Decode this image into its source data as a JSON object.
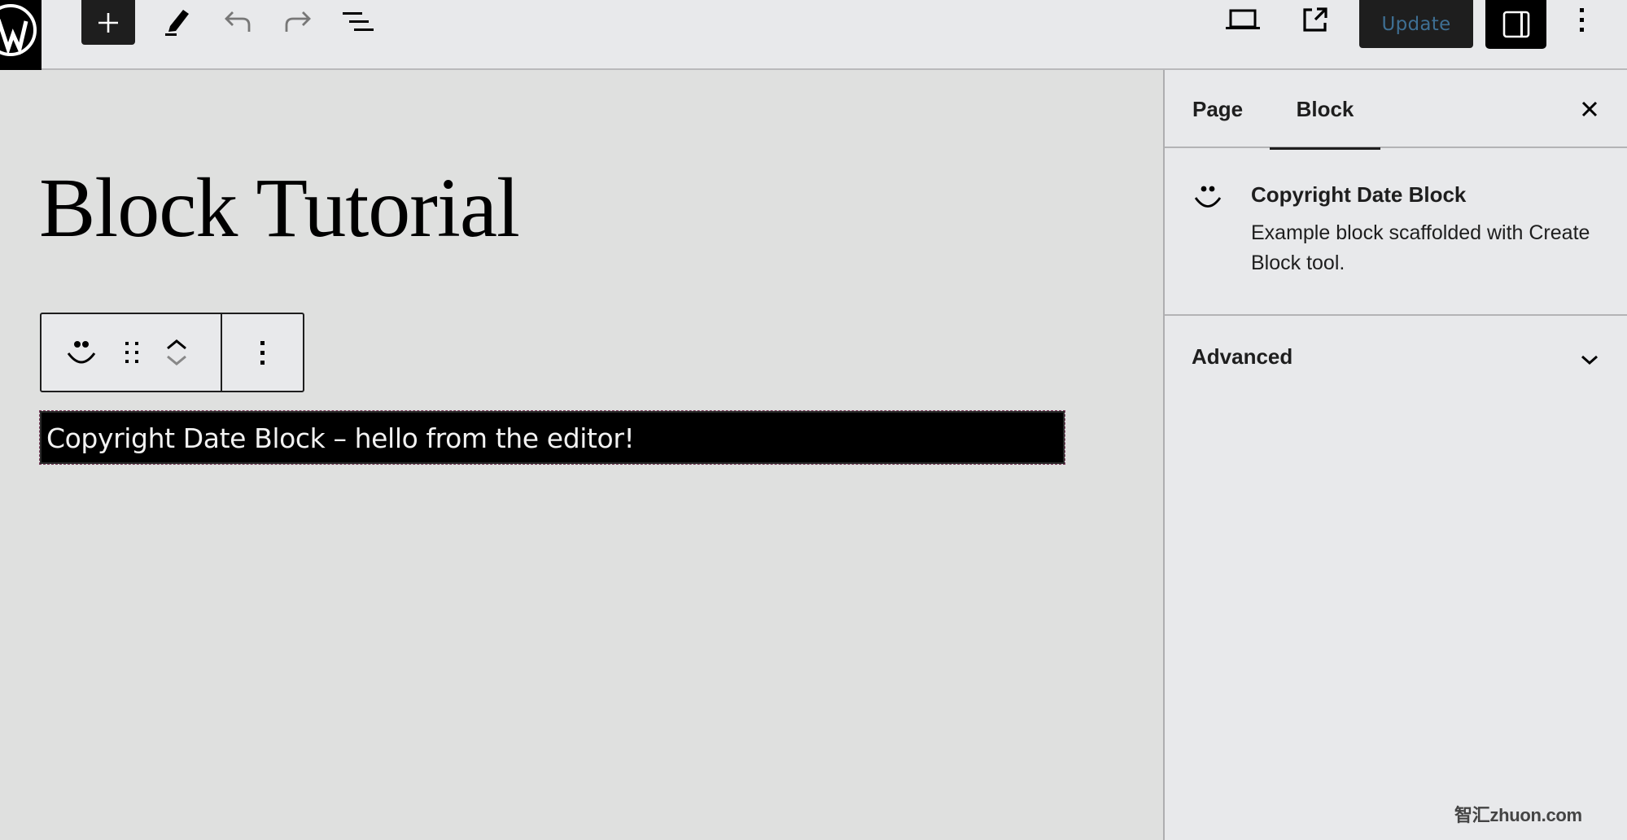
{
  "header": {
    "logo_icon": "wordpress-logo-icon",
    "inserter_icon": "plus-icon",
    "tools": [
      {
        "name": "edit-tool",
        "icon": "pencil-icon"
      },
      {
        "name": "undo",
        "icon": "undo-icon"
      },
      {
        "name": "redo",
        "icon": "redo-icon"
      },
      {
        "name": "document-overview",
        "icon": "list-view-icon"
      }
    ],
    "preview_icon": "laptop-icon",
    "view_page_icon": "external-link-icon",
    "update_label": "Update",
    "settings_icon": "sidebar-toggle-icon",
    "options_icon": "more-vertical-icon"
  },
  "canvas": {
    "page_title": "Block Tutorial",
    "block_toolbar": {
      "block_icon": "smiley-icon",
      "drag_icon": "drag-handle-icon",
      "move_up_icon": "chevron-up-icon",
      "move_down_icon": "chevron-down-icon",
      "options_icon": "more-vertical-icon"
    },
    "block_content": "Copyright Date Block – hello from the editor!"
  },
  "sidebar": {
    "tabs": [
      {
        "label": "Page",
        "active": false
      },
      {
        "label": "Block",
        "active": true
      }
    ],
    "close_icon": "close-icon",
    "block_card": {
      "icon": "smiley-icon",
      "title": "Copyright Date Block",
      "description": "Example block scaffolded with Create Block tool."
    },
    "panels": [
      {
        "label": "Advanced",
        "expanded": false
      }
    ]
  },
  "watermark": "智汇zhuon.com",
  "colors": {
    "canvas_bg": "#dfe0df",
    "sidebar_bg": "#e8e9eb",
    "dark_button": "#1e1e1e",
    "update_text": "#3e6f93"
  }
}
